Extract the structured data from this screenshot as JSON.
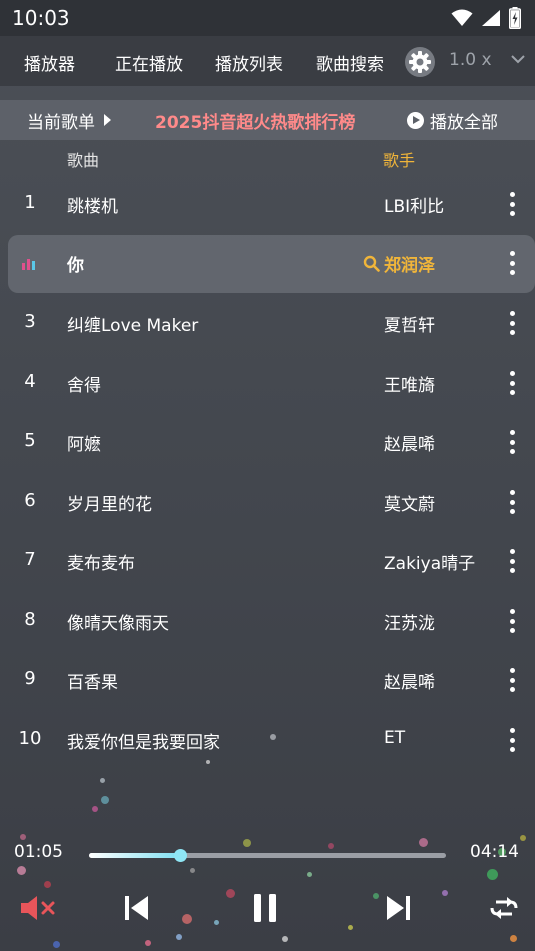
{
  "status_bar": {
    "time": "10:03"
  },
  "nav": {
    "items": [
      "播放器",
      "正在播放",
      "播放列表",
      "歌曲搜索"
    ],
    "speed": "1.0 x"
  },
  "playlist": {
    "current_label": "当前歌单",
    "title": "2025抖音超火热歌排行榜",
    "play_all_label": "播放全部"
  },
  "columns": {
    "song": "歌曲",
    "artist": "歌手"
  },
  "songs": [
    {
      "num": "1",
      "title": "跳楼机",
      "artist": "LBI利比"
    },
    {
      "num": "",
      "title": "你",
      "artist": "郑润泽"
    },
    {
      "num": "3",
      "title": "纠缠Love Maker",
      "artist": "夏哲轩"
    },
    {
      "num": "4",
      "title": "舍得",
      "artist": "王唯旖"
    },
    {
      "num": "5",
      "title": "阿嬷",
      "artist": "赵晨唏"
    },
    {
      "num": "6",
      "title": "岁月里的花",
      "artist": "莫文蔚"
    },
    {
      "num": "7",
      "title": "麦布麦布",
      "artist": "Zakiya晴子"
    },
    {
      "num": "8",
      "title": "像晴天像雨天",
      "artist": "汪苏泷"
    },
    {
      "num": "9",
      "title": "百香果",
      "artist": "赵晨唏"
    },
    {
      "num": "10",
      "title": "我爱你但是我要回家",
      "artist": "ET"
    }
  ],
  "active_index": 1,
  "player": {
    "current_time": "01:05",
    "total_time": "04:14",
    "progress": 0.255
  },
  "colors": {
    "accent_artist": "#f0b53a",
    "playlist_title": "#ff8a8a",
    "progress_fill": "#7fe0f2",
    "mute_icon": "#e8555a"
  },
  "icons": {
    "settings": "gear-icon",
    "speed_menu": "chevron-down-icon",
    "play_all": "play-circle-icon",
    "now_playing": "equalizer-icon",
    "artist_search": "search-icon",
    "row_menu": "more-vertical-icon",
    "mute": "mute-icon",
    "previous": "skip-previous-icon",
    "pause": "pause-icon",
    "next": "skip-next-icon",
    "repeat": "repeat-icon"
  }
}
